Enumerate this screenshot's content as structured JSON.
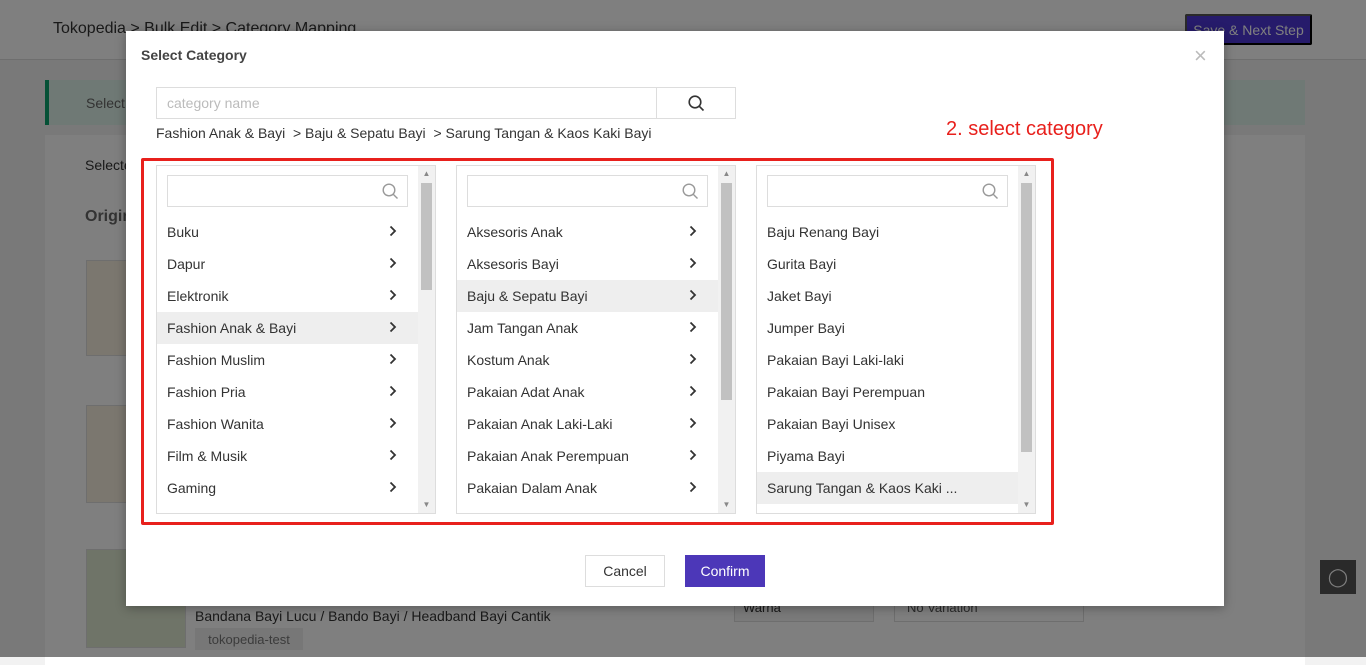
{
  "background": {
    "breadcrumb": "Tokopedia > Bulk Edit > Category Mapping",
    "save_button": "Save & Next Step",
    "tip_text": "Select",
    "selected_label": "Selecte",
    "origin_label": "Origin",
    "product_name": "Bandana Bayi Lucu / Bando Bayi / Headband Bayi Cantik",
    "shop_tag": "tokopedia-test",
    "variation_select": "Warna",
    "variation_value_select": "No Variation",
    "accent": "#4c37d6"
  },
  "modal": {
    "title": "Select Category",
    "close": "×",
    "search_placeholder": "category name",
    "search_value": "",
    "path": "Fashion Anak & Bayi  > Baju & Sepatu Bayi  > Sarung Tangan & Kaos Kaki Bayi",
    "annotation": "2. select category",
    "annotation_color": "#e8201c",
    "columns": [
      {
        "scroll_position": 0,
        "items": [
          {
            "label": "Buku"
          },
          {
            "label": "Dapur"
          },
          {
            "label": "Elektronik"
          },
          {
            "label": "Fashion Anak & Bayi",
            "selected": true
          },
          {
            "label": "Fashion Muslim"
          },
          {
            "label": "Fashion Pria"
          },
          {
            "label": "Fashion Wanita"
          },
          {
            "label": "Film & Musik"
          },
          {
            "label": "Gaming"
          }
        ]
      },
      {
        "scroll_position": 0,
        "items": [
          {
            "label": "Aksesoris Anak"
          },
          {
            "label": "Aksesoris Bayi"
          },
          {
            "label": "Baju & Sepatu Bayi",
            "selected": true
          },
          {
            "label": "Jam Tangan Anak"
          },
          {
            "label": "Kostum Anak"
          },
          {
            "label": "Pakaian Adat Anak"
          },
          {
            "label": "Pakaian Anak Laki-Laki"
          },
          {
            "label": "Pakaian Anak Perempuan"
          },
          {
            "label": "Pakaian Dalam Anak"
          }
        ]
      },
      {
        "scroll_position": 0,
        "items": [
          {
            "label": "Baju Renang Bayi"
          },
          {
            "label": "Gurita Bayi"
          },
          {
            "label": "Jaket Bayi"
          },
          {
            "label": "Jumper Bayi"
          },
          {
            "label": "Pakaian Bayi Laki-laki"
          },
          {
            "label": "Pakaian Bayi Perempuan"
          },
          {
            "label": "Pakaian Bayi Unisex"
          },
          {
            "label": "Piyama Bayi"
          },
          {
            "label": "Sarung Tangan & Kaos Kaki ...",
            "selected": true
          }
        ]
      }
    ],
    "cancel": "Cancel",
    "confirm": "Confirm",
    "confirm_color": "#4c37b8"
  }
}
